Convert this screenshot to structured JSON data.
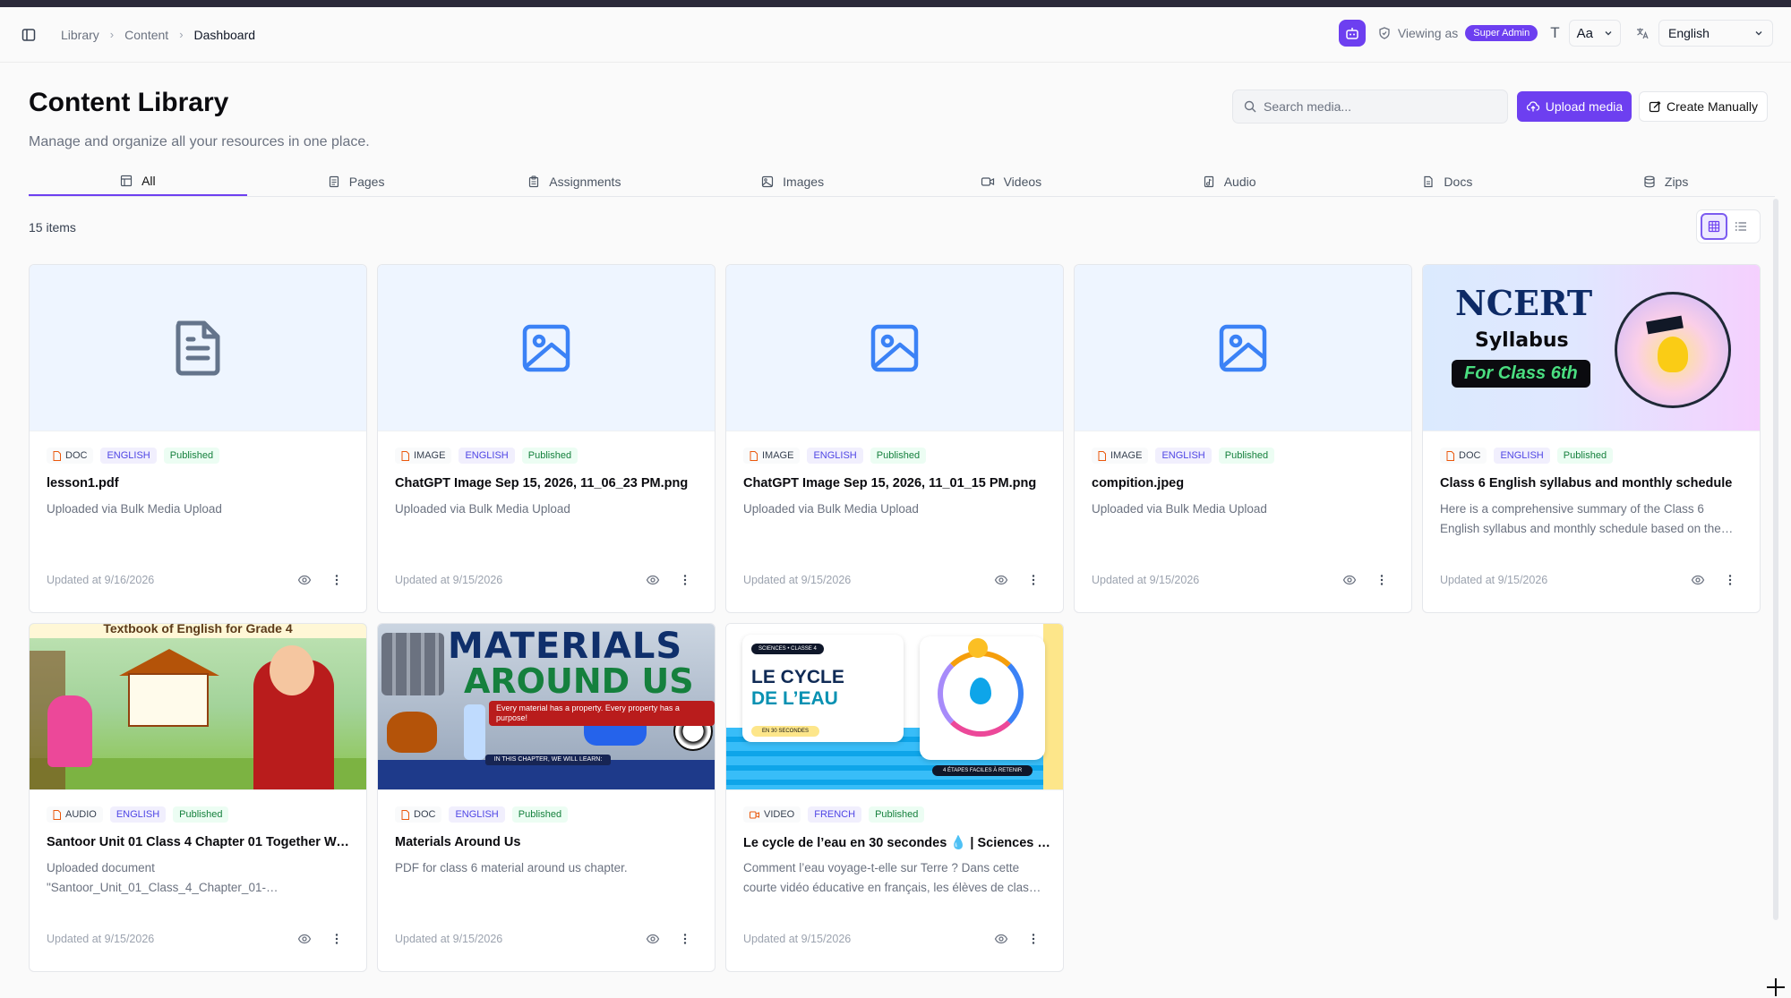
{
  "topbar": {
    "breadcrumb": [
      "Library",
      "Content",
      "Dashboard"
    ],
    "viewing_as_label": "Viewing as",
    "role_badge": "Super Admin",
    "font_size_value": "Aa",
    "language_value": "English"
  },
  "header": {
    "title": "Content Library",
    "subtitle": "Manage and organize all your resources in one place.",
    "search_placeholder": "Search media...",
    "upload_label": "Upload media",
    "create_label": "Create Manually"
  },
  "tabs": [
    {
      "label": "All",
      "icon": "layout-icon",
      "active": true
    },
    {
      "label": "Pages",
      "icon": "page-icon"
    },
    {
      "label": "Assignments",
      "icon": "clipboard-icon"
    },
    {
      "label": "Images",
      "icon": "image-icon"
    },
    {
      "label": "Videos",
      "icon": "video-icon"
    },
    {
      "label": "Audio",
      "icon": "audio-icon"
    },
    {
      "label": "Docs",
      "icon": "doc-icon"
    },
    {
      "label": "Zips",
      "icon": "archive-icon"
    }
  ],
  "count_label": "15 items",
  "view_mode": "grid",
  "colors": {
    "accent": "#6d3ff0",
    "lang_badge": "#4f46e5",
    "status_badge": "#15803d"
  },
  "cards": [
    {
      "type": "DOC",
      "language": "ENGLISH",
      "status": "Published",
      "title": "lesson1.pdf",
      "description": "Uploaded via Bulk Media Upload",
      "updated": "Updated at 9/16/2026",
      "thumb": "doc-placeholder"
    },
    {
      "type": "IMAGE",
      "language": "ENGLISH",
      "status": "Published",
      "title": "ChatGPT Image Sep 15, 2026, 11_06_23 PM.png",
      "description": "Uploaded via Bulk Media Upload",
      "updated": "Updated at 9/15/2026",
      "thumb": "image-placeholder"
    },
    {
      "type": "IMAGE",
      "language": "ENGLISH",
      "status": "Published",
      "title": "ChatGPT Image Sep 15, 2026, 11_01_15 PM.png",
      "description": "Uploaded via Bulk Media Upload",
      "updated": "Updated at 9/15/2026",
      "thumb": "image-placeholder"
    },
    {
      "type": "IMAGE",
      "language": "ENGLISH",
      "status": "Published",
      "title": "compition.jpeg",
      "description": "Uploaded via Bulk Media Upload",
      "updated": "Updated at 9/15/2026",
      "thumb": "image-placeholder"
    },
    {
      "type": "DOC",
      "language": "ENGLISH",
      "status": "Published",
      "title": "Class 6 English syllabus and monthly schedule",
      "description": "Here is a comprehensive summary of the Class 6 English syllabus and monthly schedule based on the…",
      "updated": "Updated at 9/15/2026",
      "thumb": "ncert",
      "thumb_text": {
        "line1": "NCERT",
        "line2": "Syllabus",
        "line3": "For Class 6th"
      }
    },
    {
      "type": "AUDIO",
      "language": "ENGLISH",
      "status": "Published",
      "title": "Santoor Unit 01 Class 4 Chapter 01 Together We…",
      "description": "Uploaded document \"Santoor_Unit_01_Class_4_Chapter_01-…",
      "updated": "Updated at 9/15/2026",
      "thumb": "santoor",
      "thumb_text": {
        "banner": "Textbook of English for Grade 4"
      }
    },
    {
      "type": "DOC",
      "language": "ENGLISH",
      "status": "Published",
      "title": "Materials Around Us",
      "description": "PDF for class 6 material around us chapter.",
      "updated": "Updated at 9/15/2026",
      "thumb": "materials",
      "thumb_text": {
        "line1": "MATERIALS",
        "line2": "AROUND US",
        "line3": "Every material has a property. Every property has a purpose!",
        "line4": "IN THIS CHAPTER, WE WILL LEARN:"
      }
    },
    {
      "type": "VIDEO",
      "language": "FRENCH",
      "status": "Published",
      "title": "Le cycle de l’eau en 30 secondes 💧 | Sciences –…",
      "description": "Comment l’eau voyage-t-elle sur Terre ? Dans cette courte vidéo éducative en français, les élèves de clas…",
      "updated": "Updated at 9/15/2026",
      "thumb": "cycle",
      "thumb_text": {
        "tag": "SCIENCES • CLASSE 4",
        "line1": "LE CYCLE",
        "line2": "DE L’EAU",
        "pill": "EN 30 SECONDES",
        "foot": "4 ÉTAPES FACILES À RETENIR"
      }
    }
  ]
}
